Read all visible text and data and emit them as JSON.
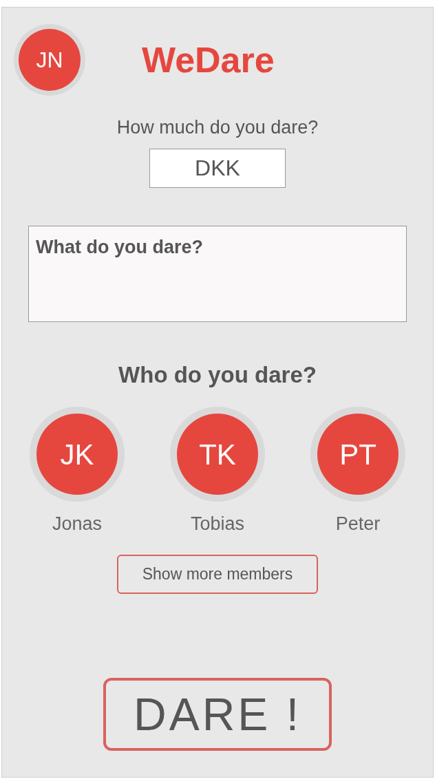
{
  "header": {
    "avatar_initials": "JN",
    "title": "WeDare"
  },
  "amount": {
    "label": "How much do you dare?",
    "value": "DKK"
  },
  "dare_text": {
    "placeholder": "What do you dare?"
  },
  "members_section": {
    "heading": "Who do you dare?",
    "members": [
      {
        "initials": "JK",
        "name": "Jonas"
      },
      {
        "initials": "TK",
        "name": "Tobias"
      },
      {
        "initials": "PT",
        "name": "Peter"
      }
    ],
    "more_button": "Show more members"
  },
  "dare_button": "DARE !"
}
